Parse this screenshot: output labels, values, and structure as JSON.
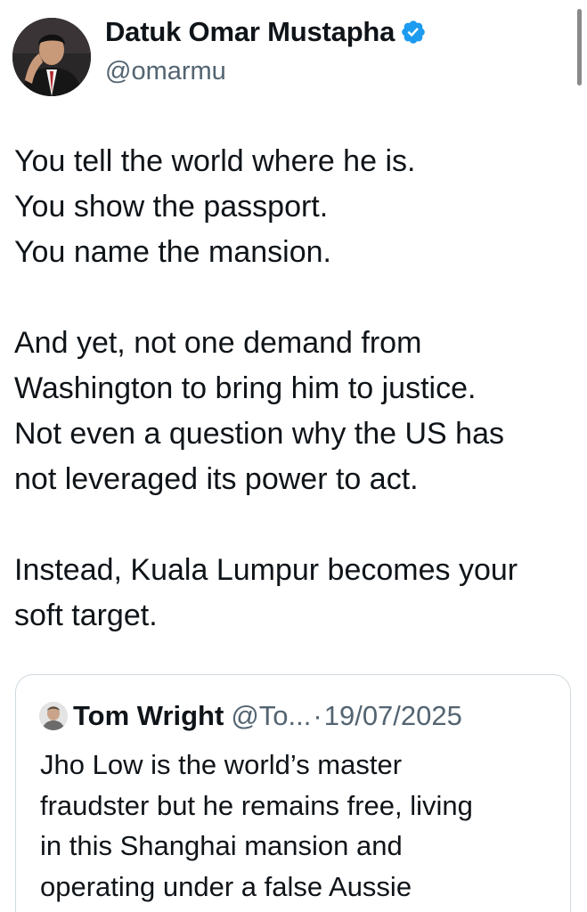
{
  "author": {
    "display_name": "Datuk Omar Mustapha",
    "handle": "@omarmu",
    "verified": true,
    "verified_color": "#1d9bf0",
    "avatar_icon": "profile-photo"
  },
  "tweet": {
    "paragraphs": [
      [
        "You tell the world where he is.",
        "You show the passport.",
        "You name the mansion."
      ],
      [
        "And yet, not one demand from",
        "Washington to bring him to justice.",
        "Not even a question why the US has",
        "not leveraged its power to act."
      ],
      [
        "Instead, Kuala Lumpur becomes your",
        "soft target."
      ]
    ]
  },
  "quoted_tweet": {
    "display_name": "Tom Wright",
    "handle": "@To...",
    "separator": "·",
    "date": "19/07/2025",
    "avatar_icon": "profile-photo",
    "lines": [
      "Jho Low is the world’s master",
      "fraudster but he remains free, living",
      "in this Shanghai mansion and",
      "operating under a false Aussie"
    ]
  },
  "colors": {
    "text_primary": "#0f1419",
    "text_secondary": "#536471",
    "card_border": "#cfd9de"
  }
}
